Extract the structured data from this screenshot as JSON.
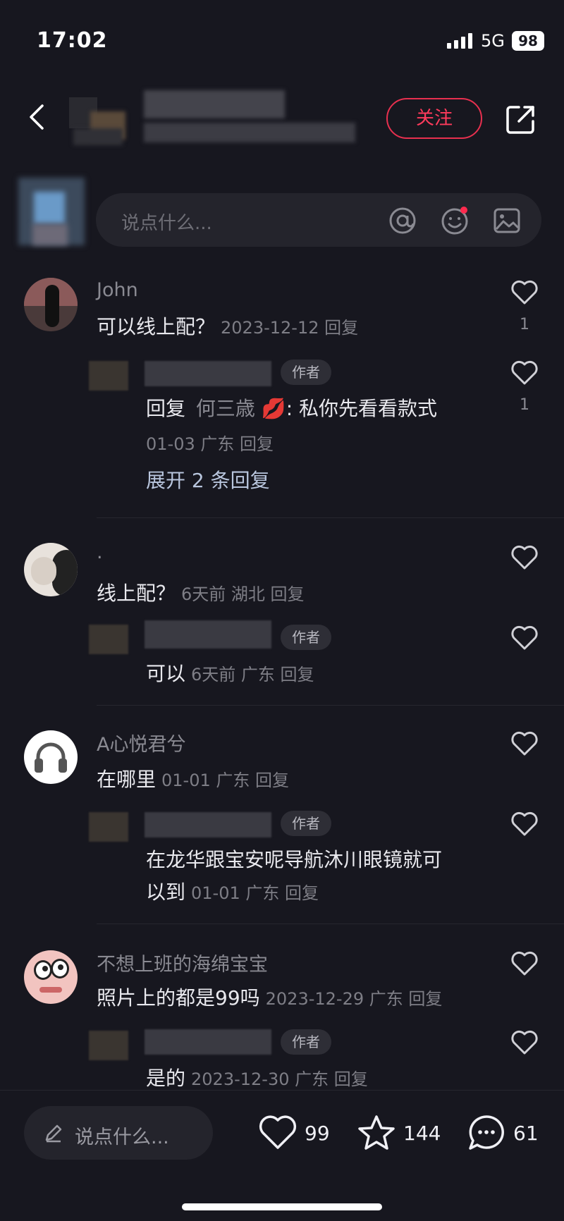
{
  "status_bar": {
    "time": "17:02",
    "network": "5G",
    "battery": "98"
  },
  "header": {
    "follow_label": "关注"
  },
  "comment_input": {
    "placeholder": "说点什么..."
  },
  "comments": [
    {
      "name": "John",
      "text": "可以线上配？",
      "meta": "2023-12-12 回复",
      "likes": "1",
      "reply": {
        "badge": "作者",
        "prefix": "回复",
        "to": "何三歳",
        "emoji": "💋",
        "text": ": 私你先看看款式",
        "meta": "01-03 广东 回复",
        "likes": "1",
        "expand": "展开 2 条回复"
      }
    },
    {
      "name": ".",
      "text": "线上配？",
      "meta": "6天前 湖北 回复",
      "reply": {
        "badge": "作者",
        "text": "可以",
        "meta": "6天前 广东 回复"
      }
    },
    {
      "name": "A心悦君兮",
      "text": "在哪里",
      "meta": "01-01 广东 回复",
      "reply": {
        "badge": "作者",
        "text_line1": "在龙华跟宝安呢导航沐川眼镜就可",
        "text_line2": "以到",
        "meta": "01-01 广东 回复"
      }
    },
    {
      "name": "不想上班的海绵宝宝",
      "text": "照片上的都是99吗",
      "meta": "2023-12-29 广东 回复",
      "reply": {
        "badge": "作者",
        "text": "是的",
        "meta": "2023-12-30 广东 回复"
      }
    }
  ],
  "bottom_bar": {
    "placeholder": "说点什么...",
    "likes": "99",
    "favorites": "144",
    "comments": "61"
  }
}
